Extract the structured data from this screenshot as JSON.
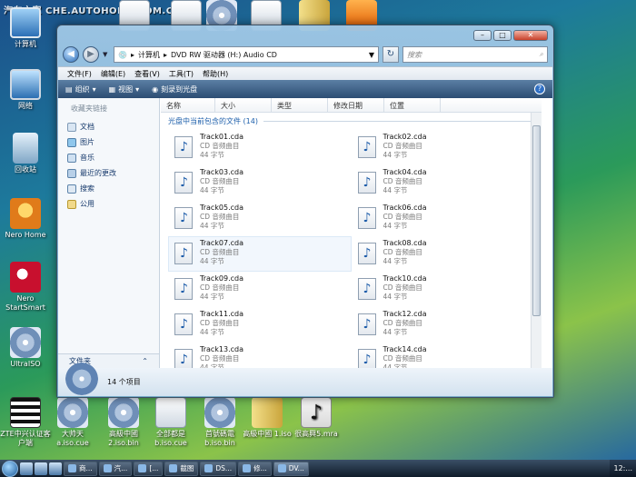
{
  "watermark": "汽车之家 CHE.AUTOHOME.COM.CN",
  "desktop": {
    "icons": {
      "computer": "计算机",
      "network": "网络",
      "recycle": "回收站",
      "nerohome": "Nero Home",
      "nero": "Nero StartSmart",
      "ultraiso": "UltraISO",
      "zte": "ZTE中兴认证客户端",
      "b1": "大帅天 a.iso.cue",
      "b2": "高級中國 2.iso.bin",
      "b3": "全部都是 b.iso.cue",
      "b4": "首號碼電 b.iso.bin",
      "b5": "高級中國 1.iso",
      "b6": "很高興5.mra"
    }
  },
  "window": {
    "nav_path": [
      "计算机",
      "DVD RW 驱动器 (H:) Audio CD"
    ],
    "search_placeholder": "搜索",
    "menu": [
      "文件(F)",
      "编辑(E)",
      "查看(V)",
      "工具(T)",
      "帮助(H)"
    ],
    "toolbar": {
      "organize": "组织",
      "views": "视图",
      "burn": "刻录到光盘"
    },
    "nav_pane": {
      "header": "收藏夹链接",
      "items": [
        "文档",
        "图片",
        "音乐",
        "最近的更改",
        "搜索",
        "公用"
      ],
      "footer": "文件夹"
    },
    "columns": [
      "名称",
      "大小",
      "类型",
      "修改日期",
      "位置"
    ],
    "group_title": "光盘中当前包含的文件 (14)",
    "files": [
      {
        "name": "Track01.cda",
        "type": "CD 音频曲目",
        "size": "44 字节"
      },
      {
        "name": "Track02.cda",
        "type": "CD 音频曲目",
        "size": "44 字节"
      },
      {
        "name": "Track03.cda",
        "type": "CD 音频曲目",
        "size": "44 字节"
      },
      {
        "name": "Track04.cda",
        "type": "CD 音频曲目",
        "size": "44 字节"
      },
      {
        "name": "Track05.cda",
        "type": "CD 音频曲目",
        "size": "44 字节"
      },
      {
        "name": "Track06.cda",
        "type": "CD 音频曲目",
        "size": "44 字节"
      },
      {
        "name": "Track07.cda",
        "type": "CD 音频曲目",
        "size": "44 字节"
      },
      {
        "name": "Track08.cda",
        "type": "CD 音频曲目",
        "size": "44 字节"
      },
      {
        "name": "Track09.cda",
        "type": "CD 音频曲目",
        "size": "44 字节"
      },
      {
        "name": "Track10.cda",
        "type": "CD 音频曲目",
        "size": "44 字节"
      },
      {
        "name": "Track11.cda",
        "type": "CD 音频曲目",
        "size": "44 字节"
      },
      {
        "name": "Track12.cda",
        "type": "CD 音频曲目",
        "size": "44 字节"
      },
      {
        "name": "Track13.cda",
        "type": "CD 音频曲目",
        "size": "44 字节"
      },
      {
        "name": "Track14.cda",
        "type": "CD 音频曲目",
        "size": "44 字节"
      }
    ],
    "selected_index": 6,
    "status": "14 个项目"
  },
  "taskbar": {
    "buttons": [
      "商...",
      "汽...",
      "[...",
      "截图",
      "DS...",
      "修...",
      "DV..."
    ],
    "tray": "12:..."
  }
}
